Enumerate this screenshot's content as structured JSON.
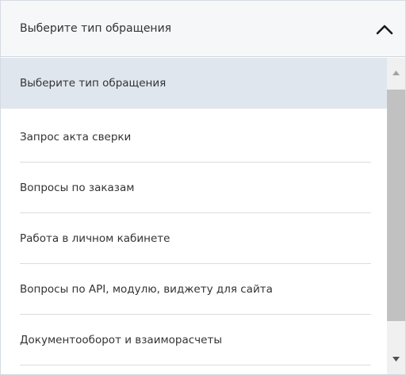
{
  "dropdown": {
    "selected_label": "Выберите тип обращения",
    "expanded_indicator_icon": "chevron-up-icon",
    "options": [
      {
        "label": "Выберите тип обращения",
        "selected": true
      },
      {
        "label": "Запрос акта сверки",
        "selected": false
      },
      {
        "label": "Вопросы по заказам",
        "selected": false
      },
      {
        "label": "Работа в личном кабинете",
        "selected": false
      },
      {
        "label": "Вопросы по API, модулю, виджету для сайта",
        "selected": false
      },
      {
        "label": "Документооборот и взаиморасчеты",
        "selected": false
      }
    ]
  },
  "scrollbar": {
    "up_icon": "scroll-up-arrow-icon",
    "down_icon": "scroll-down-arrow-icon"
  },
  "colors": {
    "selected_option_bg": "#dfe6ee",
    "header_bg": "#f5f7f9",
    "divider": "#d9dde1",
    "text": "#333333",
    "scroll_thumb": "#c1c1c1"
  }
}
